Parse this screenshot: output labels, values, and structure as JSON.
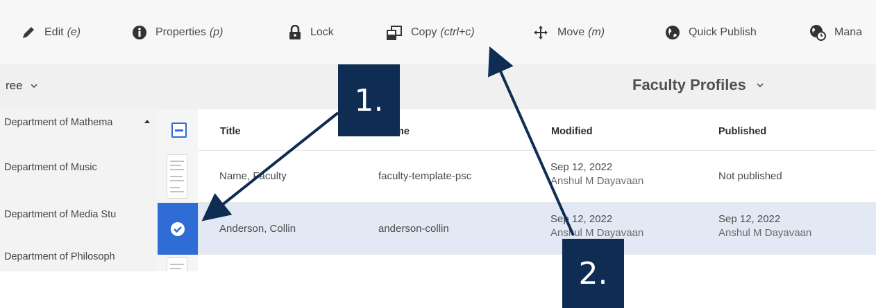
{
  "toolbar": {
    "edit": {
      "label": "Edit",
      "shortcut": "(e)"
    },
    "properties": {
      "label": "Properties",
      "shortcut": "(p)"
    },
    "lock": {
      "label": "Lock"
    },
    "copy": {
      "label": "Copy",
      "shortcut": "(ctrl+c)"
    },
    "move": {
      "label": "Move",
      "shortcut": "(m)"
    },
    "quick_publish": {
      "label": "Quick Publish"
    },
    "manage": {
      "label": "Mana"
    }
  },
  "header": {
    "tree_title": "ree",
    "folder_title": "Faculty Profiles"
  },
  "sidebar": {
    "items": [
      {
        "label": "Department of Mathema"
      },
      {
        "label": "Department of Music"
      },
      {
        "label": "Department of Media Stu"
      },
      {
        "label": "Department of Philosoph"
      }
    ]
  },
  "table": {
    "columns": [
      "Title",
      "me",
      "Modified",
      "Published"
    ],
    "rows": [
      {
        "title": "Name, Faculty",
        "name": "faculty-template-psc",
        "modified_date": "Sep 12, 2022",
        "modified_by": "Anshul M Dayavaan",
        "published": "Not published",
        "published_by": ""
      },
      {
        "title": "Anderson, Collin",
        "name": "anderson-collin",
        "modified_date": "Sep 12, 2022",
        "modified_by": "Anshul M Dayavaan",
        "published": "Sep 12, 2022",
        "published_by": "Anshul M Dayavaan"
      }
    ]
  },
  "annotations": {
    "callout_1": "1.",
    "callout_2": "2."
  },
  "colors": {
    "accent": "#2f6cd6",
    "callout": "#0f2d52",
    "selected_row": "#e3e9f4"
  }
}
